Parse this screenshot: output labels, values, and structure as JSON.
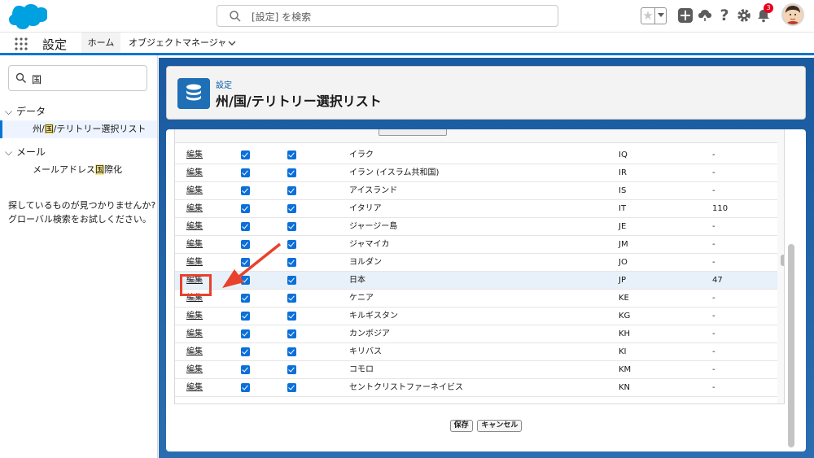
{
  "header": {
    "search_placeholder": "[設定] を検索",
    "notification_count": "3"
  },
  "nav": {
    "app_name": "設定",
    "tab_home": "ホーム",
    "tab_object_manager": "オブジェクトマネージャ"
  },
  "sidebar": {
    "search_value": "国",
    "group_data": "データ",
    "item_territory_pre": "州/",
    "item_territory_hl": "国",
    "item_territory_post": "/テリトリー選択リスト",
    "group_mail": "メール",
    "item_mail_pre": "メールアドレス",
    "item_mail_hl": "国",
    "item_mail_post": "際化",
    "help_line1": "探しているものが見つかりませんか?",
    "help_line2": "グローバル検索をお試しください。"
  },
  "page": {
    "kicker": "設定",
    "title": "州/国/テリトリー選択リスト"
  },
  "table": {
    "edit_label": "編集",
    "rows": [
      {
        "name": "イラク",
        "code": "IQ",
        "num": "-"
      },
      {
        "name": "イラン (イスラム共和国)",
        "code": "IR",
        "num": "-"
      },
      {
        "name": "アイスランド",
        "code": "IS",
        "num": "-"
      },
      {
        "name": "イタリア",
        "code": "IT",
        "num": "110"
      },
      {
        "name": "ジャージー島",
        "code": "JE",
        "num": "-"
      },
      {
        "name": "ジャマイカ",
        "code": "JM",
        "num": "-"
      },
      {
        "name": "ヨルダン",
        "code": "JO",
        "num": "-"
      },
      {
        "name": "日本",
        "code": "JP",
        "num": "47"
      },
      {
        "name": "ケニア",
        "code": "KE",
        "num": "-"
      },
      {
        "name": "キルギスタン",
        "code": "KG",
        "num": "-"
      },
      {
        "name": "カンボジア",
        "code": "KH",
        "num": "-"
      },
      {
        "name": "キリバス",
        "code": "KI",
        "num": "-"
      },
      {
        "name": "コモロ",
        "code": "KM",
        "num": "-"
      },
      {
        "name": "セントクリストファーネイビス",
        "code": "KN",
        "num": "-"
      }
    ]
  },
  "buttons": {
    "save": "保存",
    "cancel": "キャンセル"
  },
  "colors": {
    "brand": "#0176d3",
    "annotation": "#e8412c"
  }
}
